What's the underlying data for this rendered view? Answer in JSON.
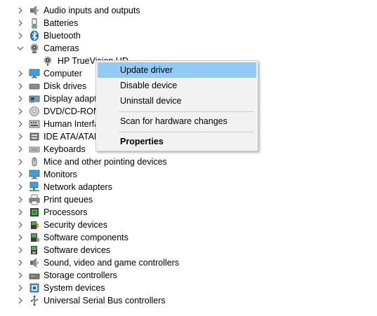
{
  "tree": {
    "categories": [
      {
        "label": "Audio inputs and outputs",
        "icon": "speaker-icon",
        "expanded": false
      },
      {
        "label": "Batteries",
        "icon": "battery-icon",
        "expanded": false
      },
      {
        "label": "Bluetooth",
        "icon": "bluetooth-icon",
        "expanded": false
      },
      {
        "label": "Cameras",
        "icon": "camera-icon",
        "expanded": true
      },
      {
        "label": "Computer",
        "icon": "computer-icon",
        "expanded": false
      },
      {
        "label": "Disk drives",
        "icon": "disk-drive-icon",
        "expanded": false
      },
      {
        "label": "Display adapte",
        "icon": "display-adapter-icon",
        "expanded": false
      },
      {
        "label": "DVD/CD-ROM",
        "icon": "dvd-icon",
        "expanded": false
      },
      {
        "label": "Human Interfa",
        "icon": "keyboard-hid-icon",
        "expanded": false
      },
      {
        "label": "IDE ATA/ATAP",
        "icon": "ide-controller-icon",
        "expanded": false
      },
      {
        "label": "Keyboards",
        "icon": "keyboard-icon",
        "expanded": false
      },
      {
        "label": "Mice and other pointing devices",
        "icon": "mouse-icon",
        "expanded": false
      },
      {
        "label": "Monitors",
        "icon": "monitor-icon",
        "expanded": false
      },
      {
        "label": "Network adapters",
        "icon": "network-icon",
        "expanded": false
      },
      {
        "label": "Print queues",
        "icon": "printer-icon",
        "expanded": false
      },
      {
        "label": "Processors",
        "icon": "processor-icon",
        "expanded": false
      },
      {
        "label": "Security devices",
        "icon": "security-device-icon",
        "expanded": false
      },
      {
        "label": "Software components",
        "icon": "software-component-icon",
        "expanded": false
      },
      {
        "label": "Software devices",
        "icon": "software-device-icon",
        "expanded": false
      },
      {
        "label": "Sound, video and game controllers",
        "icon": "speaker-icon",
        "expanded": false
      },
      {
        "label": "Storage controllers",
        "icon": "storage-controller-icon",
        "expanded": false
      },
      {
        "label": "System devices",
        "icon": "system-device-icon",
        "expanded": false
      },
      {
        "label": "Universal Serial Bus controllers",
        "icon": "usb-icon",
        "expanded": false
      }
    ],
    "camera_child": {
      "label": "HP TrueVision HD",
      "icon": "webcam-icon"
    }
  },
  "context_menu": {
    "items": [
      {
        "label": "Update driver",
        "highlighted": true
      },
      {
        "label": "Disable device"
      },
      {
        "label": "Uninstall device"
      },
      {
        "label": "Scan for hardware changes"
      },
      {
        "label": "Properties",
        "bold": true
      }
    ]
  },
  "colors": {
    "menu_highlight": "#91c9f7",
    "menu_bg": "#f2f2f2",
    "chevron": "#5a5a5a"
  }
}
